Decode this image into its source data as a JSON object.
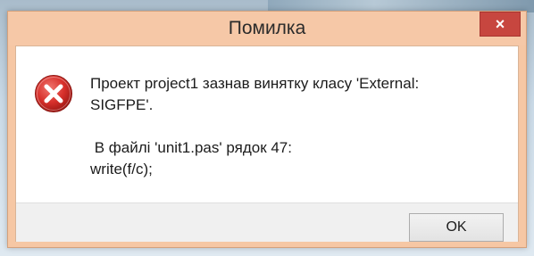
{
  "dialog": {
    "title": "Помилка",
    "close_label": "×",
    "icon": "error-icon",
    "message_line1": "Проект project1 зазнав винятку класу 'External:",
    "message_line2": "SIGFPE'.",
    "message_line3": " В файлі 'unit1.pas' рядок 47:",
    "message_line4": "write(f/c);",
    "ok_label": "OK"
  },
  "colors": {
    "titlebar": "#f6c8a7",
    "close_button": "#c7463f",
    "error_icon": "#d7302b"
  }
}
